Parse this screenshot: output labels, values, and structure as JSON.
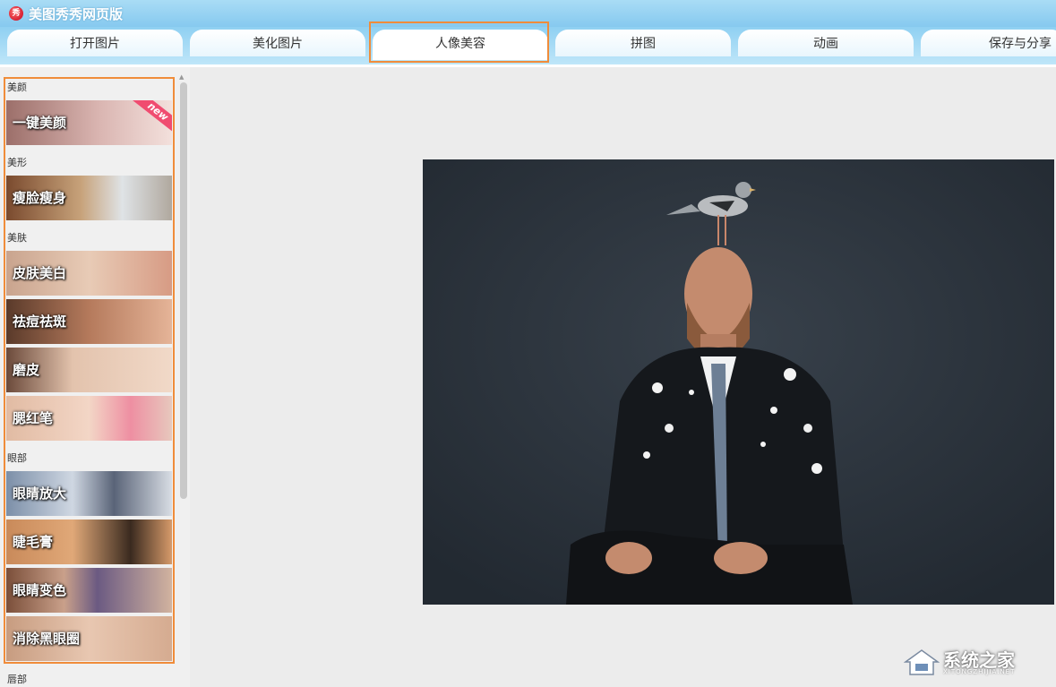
{
  "app": {
    "title": "美图秀秀网页版",
    "logo_text": "秀"
  },
  "tabs": [
    {
      "label": "打开图片"
    },
    {
      "label": "美化图片"
    },
    {
      "label": "人像美容"
    },
    {
      "label": "拼图"
    },
    {
      "label": "动画"
    },
    {
      "label": "保存与分享"
    }
  ],
  "active_tab": "人像美容",
  "sidebar": {
    "sections": [
      {
        "title": "美颜",
        "items": [
          {
            "label": "一键美颜",
            "badge": "new"
          }
        ]
      },
      {
        "title": "美形",
        "items": [
          {
            "label": "瘦脸瘦身"
          }
        ]
      },
      {
        "title": "美肤",
        "items": [
          {
            "label": "皮肤美白"
          },
          {
            "label": "祛痘祛斑"
          },
          {
            "label": "磨皮"
          },
          {
            "label": "腮红笔"
          }
        ]
      },
      {
        "title": "眼部",
        "items": [
          {
            "label": "眼睛放大"
          },
          {
            "label": "睫毛膏"
          },
          {
            "label": "眼睛变色"
          },
          {
            "label": "消除黑眼圈"
          }
        ]
      },
      {
        "title": "唇部",
        "items": []
      }
    ]
  },
  "watermark": {
    "text": "系统之家",
    "sub": "XITONGZHIJIA.NET"
  },
  "colors": {
    "highlight": "#f08c3a",
    "tab_bar": "#8fd0f2",
    "canvas_bg": "#2b333c"
  }
}
